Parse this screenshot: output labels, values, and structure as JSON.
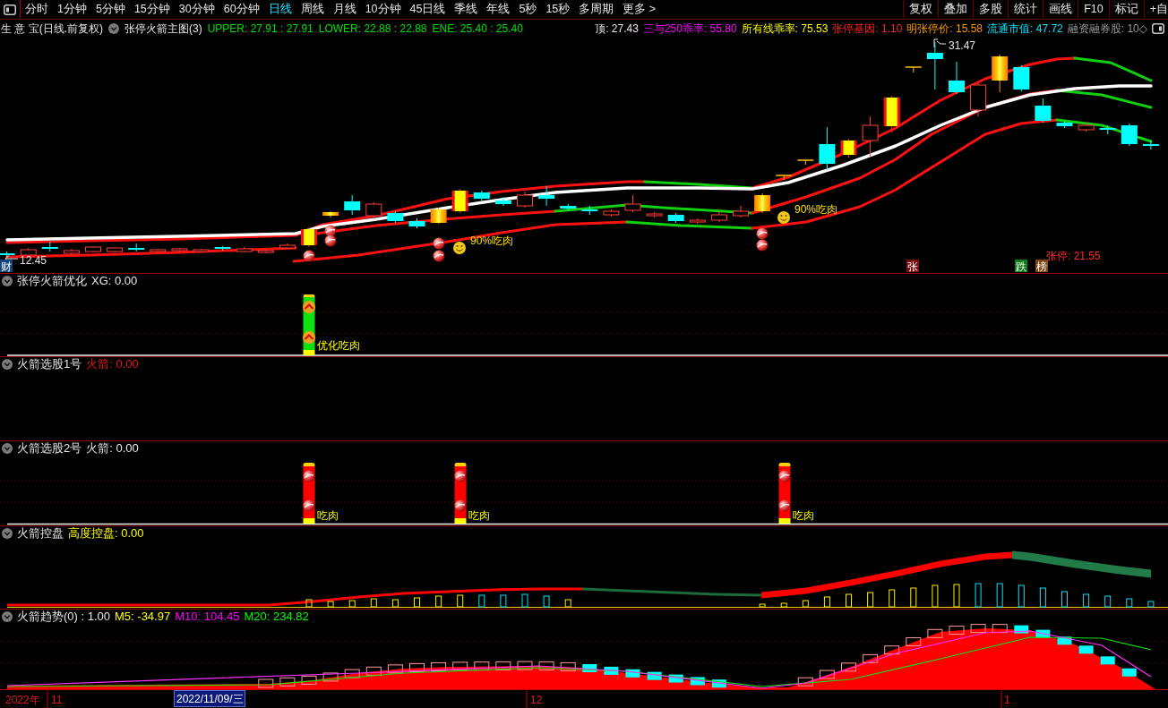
{
  "toolbar": {
    "periods": [
      {
        "label": "分时",
        "selected": false
      },
      {
        "label": "1分钟",
        "selected": false
      },
      {
        "label": "5分钟",
        "selected": false
      },
      {
        "label": "15分钟",
        "selected": false
      },
      {
        "label": "30分钟",
        "selected": false
      },
      {
        "label": "60分钟",
        "selected": false
      },
      {
        "label": "日线",
        "selected": true
      },
      {
        "label": "周线",
        "selected": false
      },
      {
        "label": "月线",
        "selected": false
      },
      {
        "label": "10分钟",
        "selected": false
      },
      {
        "label": "45日线",
        "selected": false
      },
      {
        "label": "季线",
        "selected": false
      },
      {
        "label": "年线",
        "selected": false
      },
      {
        "label": "5秒",
        "selected": false
      },
      {
        "label": "15秒",
        "selected": false
      },
      {
        "label": "多周期",
        "selected": false
      }
    ],
    "more_menu": "更多 >",
    "buttons": [
      "复权",
      "叠加",
      "多股",
      "统计",
      "画线",
      "F10",
      "标记",
      "+自"
    ]
  },
  "main_chart": {
    "security": "生 意 宝(日线.前复权)",
    "indicator": "张停火箭主图(3)",
    "readouts": [
      {
        "text": "UPPER: 27.91 : 27.91",
        "color": "#00e000"
      },
      {
        "text": "LOWER: 22.88 : 22.88",
        "color": "#00e000"
      },
      {
        "text": "ENE: 25.40 : 25.40",
        "color": "#00e000"
      }
    ],
    "stats": [
      {
        "text": "顶: 27.43",
        "color": "#e6e6e6"
      },
      {
        "text": "三与250乖率: 55.80",
        "color": "#ff00ff"
      },
      {
        "text": "所有线乖率: 75.53",
        "color": "#ffff00"
      },
      {
        "text": "张停基因: 1.10",
        "color": "#ff2020"
      },
      {
        "text": "明张停价: 15.58",
        "color": "#ff9900"
      },
      {
        "text": "流通市值: 47.72",
        "color": "#00e5ff"
      },
      {
        "text": "融资融券股: 10◇",
        "color": "#9a9a9a"
      }
    ],
    "high_label": "31.47",
    "low_label": "12.45",
    "signals": [
      {
        "text": "90%吃肉"
      },
      {
        "text": "90%吃肉"
      }
    ],
    "limit_up_label": "张停: 21.55",
    "tags": [
      {
        "text": "财",
        "color": "#16457e"
      },
      {
        "text": "张",
        "color": "#7d0c0c"
      },
      {
        "text": "跌",
        "color": "#0d7d16"
      },
      {
        "text": "榜",
        "color": "#7d4612"
      }
    ]
  },
  "panels": [
    {
      "kind": "optimize",
      "title": "张停火箭优化",
      "readouts": [
        {
          "text": "XG: 0.00",
          "color": "#e6e6e6"
        }
      ],
      "signal_labels": [
        "优化吃肉"
      ]
    },
    {
      "kind": "empty",
      "title": "火箭选股1号",
      "readouts": [
        {
          "text": "火箭: 0.00",
          "color": "#e01818"
        }
      ]
    },
    {
      "kind": "signal",
      "title": "火箭选股2号",
      "readouts": [
        {
          "text": "火箭: 0.00",
          "color": "#e6e6e6"
        }
      ],
      "signal_labels": [
        "吃肉",
        "吃肉",
        "吃肉"
      ]
    },
    {
      "kind": "ribbon",
      "title": "火箭控盘",
      "readouts": [
        {
          "text": "高度控盘: 0.00",
          "color": "#ffff00"
        }
      ]
    },
    {
      "kind": "trend",
      "title": "火箭趋势(0) : 1.00",
      "readouts": [
        {
          "text": "M5: -34.97",
          "color": "#ffff00"
        },
        {
          "text": "M10: 104.45",
          "color": "#ff00ff"
        },
        {
          "text": "M20: 234.82",
          "color": "#00ff00"
        }
      ]
    }
  ],
  "time_axis": {
    "labels": [
      "2022年",
      "11",
      "12",
      "1"
    ],
    "cursor_date": "2022/11/09/三"
  }
}
